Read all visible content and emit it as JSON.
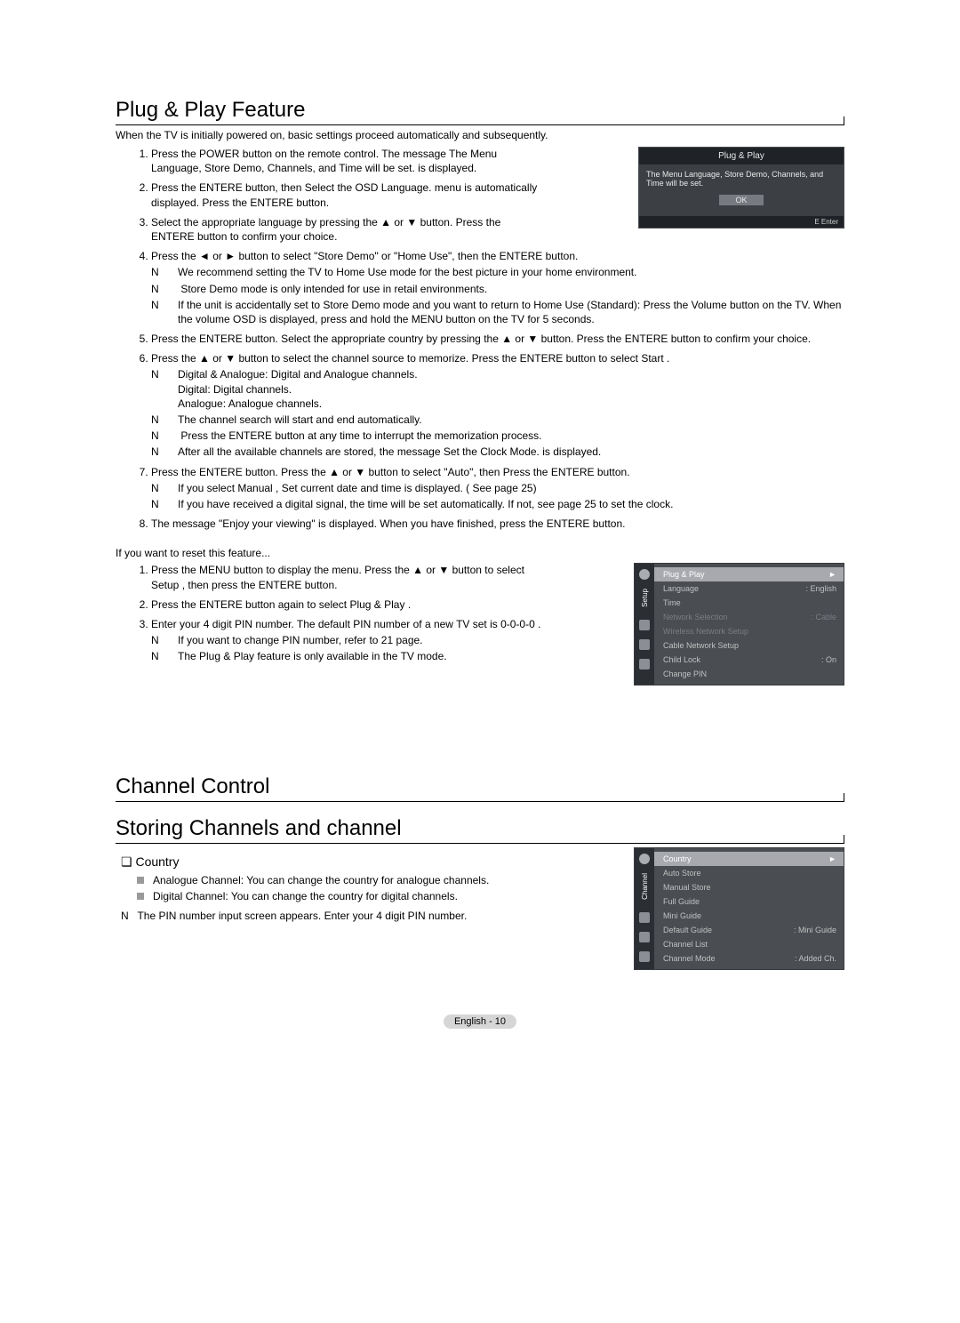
{
  "section1": {
    "title": "Plug & Play Feature",
    "intro": "When the TV is initially powered on, basic settings proceed automatically and subsequently.",
    "steps": [
      "Press the POWER button on the remote control. The message  The Menu Language, Store Demo, Channels, and Time will be set.  is displayed.",
      "Press the ENTERE   button, then  Select the OSD Language.  menu is automatically displayed. Press the ENTERE   button.",
      "Select the appropriate language by pressing the ▲ or ▼ button. Press the ENTERE   button to confirm your choice.",
      "Press the ◄ or ► button to select \"Store Demo\" or \"Home Use\", then the ENTERE   button.",
      "Press the ENTERE   button. Select the appropriate country by pressing the ▲ or ▼ button. Press the ENTERE   button to confirm your choice.",
      "Press the ▲ or ▼ button to select the channel source to memorize. Press the ENTERE   button to select  Start .",
      "Press the ENTERE   button. Press the ▲ or ▼ button to select \"Auto\", then Press the ENTERE   button.",
      "The message \"Enjoy your viewing\" is displayed. When you have finished, press the ENTERE   button."
    ],
    "notes4": [
      "We recommend setting the TV to  Home Use  mode for the best picture in your home environment.",
      " Store Demo  mode is only intended for use in retail environments.",
      "If the unit is accidentally set to  Store Demo  mode and you want to return to  Home Use  (Standard): Press the Volume button on the TV. When the volume OSD is displayed, press and hold the MENU button on the TV for 5 seconds."
    ],
    "notes6": [
      "Digital & Analogue: Digital and Analogue channels.\nDigital: Digital channels.\nAnalogue: Analogue channels.",
      "The channel search will start and end automatically.",
      " Press the ENTERE   button at any time to interrupt the memorization process.",
      "After all the available channels are stored, the message  Set the Clock Mode.  is displayed."
    ],
    "notes7": [
      "If you select  Manual ,  Set current date and time  is displayed. ( See page 25)",
      "If you have received a digital signal, the time will be set automatically. If not, see page 25 to set the clock."
    ],
    "reset": {
      "heading": "If you want to reset this feature...",
      "steps": [
        "Press the MENU button to display the menu. Press the ▲ or ▼ button to select  Setup , then press the ENTERE   button.",
        "Press the ENTERE   button again to select  Plug & Play .",
        "Enter your 4 digit PIN number. The default PIN number of a new TV set is  0-0-0-0 ."
      ],
      "notes": [
        "If you want to change PIN number, refer to 21 page.",
        "The  Plug & Play  feature is only available in the TV mode."
      ]
    }
  },
  "osd_dialog": {
    "title": "Plug & Play",
    "body": "The Menu Language, Store Demo, Channels, and Time will be set.",
    "ok": "OK",
    "footer": "E   Enter"
  },
  "setup_menu": {
    "tab_label": "Setup",
    "rows": [
      {
        "label": "Plug & Play",
        "value": "",
        "active": true,
        "arrow": "►"
      },
      {
        "label": "Language",
        "value": ": English"
      },
      {
        "label": "Time",
        "value": ""
      },
      {
        "label": "Network Selection",
        "value": ": Cable",
        "disabled": true
      },
      {
        "label": "Wireless Network Setup",
        "value": "",
        "disabled": true
      },
      {
        "label": "Cable Network Setup",
        "value": ""
      },
      {
        "label": "Child Lock",
        "value": ": On"
      },
      {
        "label": "Change PIN",
        "value": ""
      }
    ]
  },
  "chapter": {
    "title": "Channel Control"
  },
  "section2": {
    "title": "Storing Channels and channel",
    "sub_heading": "Country",
    "items": [
      "Analogue Channel: You can change the country for analogue channels.",
      "Digital Channel: You can change the country for digital channels."
    ],
    "note": "The PIN number input screen appears. Enter your 4 digit PIN number."
  },
  "channel_menu": {
    "tab_label": "Channel",
    "rows": [
      {
        "label": "Country",
        "value": "",
        "active": true,
        "arrow": "►"
      },
      {
        "label": "Auto Store",
        "value": ""
      },
      {
        "label": "Manual Store",
        "value": ""
      },
      {
        "label": "Full Guide",
        "value": ""
      },
      {
        "label": "Mini Guide",
        "value": ""
      },
      {
        "label": "Default Guide",
        "value": ": Mini Guide"
      },
      {
        "label": "Channel List",
        "value": ""
      },
      {
        "label": "Channel Mode",
        "value": ": Added Ch."
      }
    ]
  },
  "footer": "English - 10"
}
